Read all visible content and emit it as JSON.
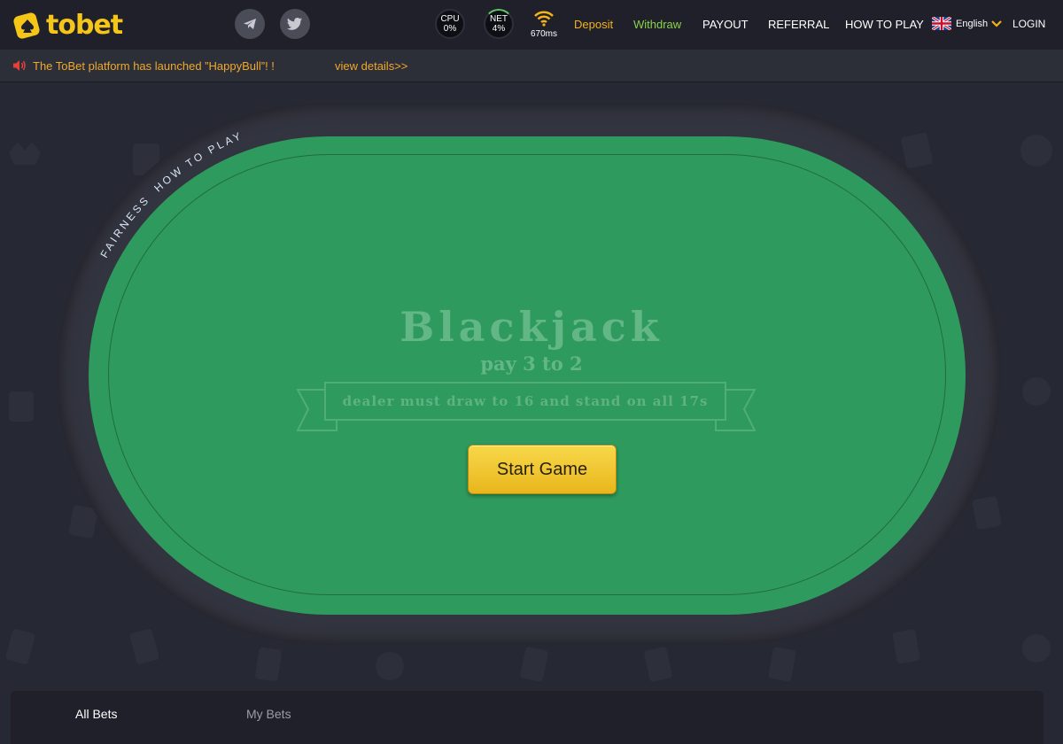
{
  "brand": {
    "name": "tobet",
    "logo_color": "#f5c518"
  },
  "header": {
    "social": [
      {
        "icon": "telegram-icon"
      },
      {
        "icon": "twitter-icon"
      }
    ],
    "stats": {
      "cpu_label": "CPU",
      "cpu_value": "0%",
      "net_label": "NET",
      "net_value": "4%",
      "ping": "670ms"
    },
    "nav": {
      "deposit": "Deposit",
      "withdraw": "Withdraw",
      "payout": "PAYOUT",
      "referral": "REFERRAL",
      "how_to_play": "HOW TO PLAY",
      "login": "LOGIN"
    },
    "language": "English",
    "colors": {
      "deposit": "#f5b31a",
      "withdraw": "#8bd24a"
    }
  },
  "announcement": {
    "text": "The ToBet platform has launched ”HappyBull”! !",
    "link": "view details>>",
    "color": "#f0a82c"
  },
  "table": {
    "curved_labels": {
      "fairness": "FAIRNESS",
      "how_to_play": "HOW TO PLAY"
    },
    "title": "Blackjack",
    "subtitle": "pay 3 to 2",
    "rule": "dealer must draw to 16 and stand on all 17s",
    "start_button": "Start Game",
    "felt_color": "#2f9a5d"
  },
  "bets": {
    "tabs": [
      "All Bets",
      "My Bets"
    ],
    "active_tab": "All Bets"
  }
}
